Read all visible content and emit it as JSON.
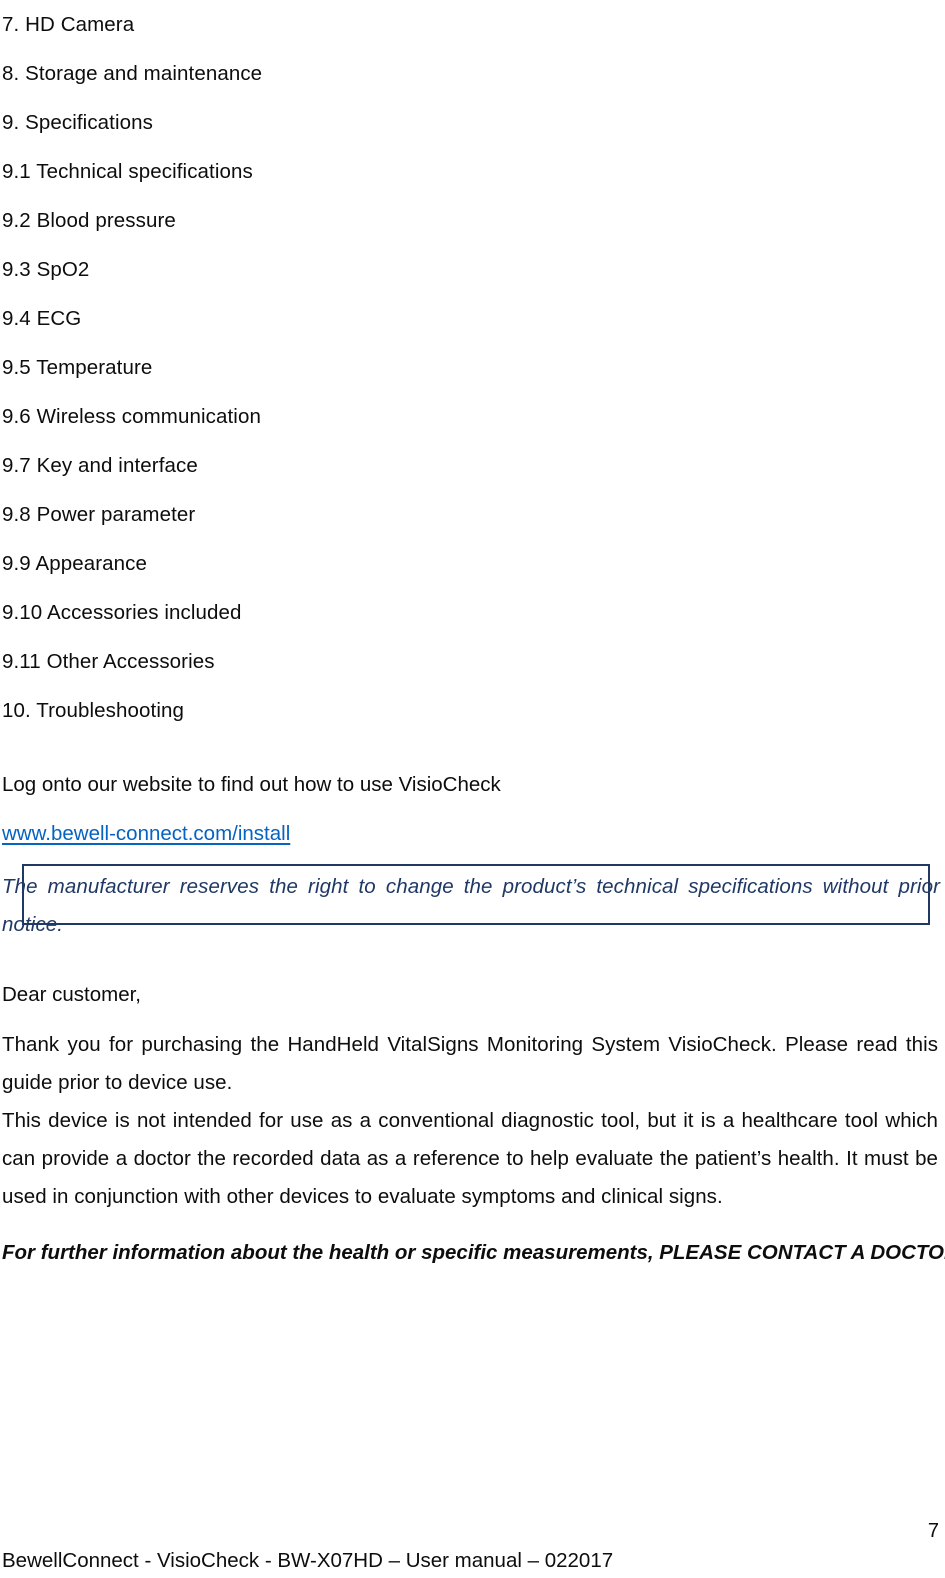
{
  "document": {
    "toc": [
      {
        "label": "7. HD Camera"
      },
      {
        "label": "8. Storage and maintenance"
      },
      {
        "label": "9. Specifications"
      },
      {
        "label": "9.1 Technical specifications"
      },
      {
        "label": "9.2 Blood pressure"
      },
      {
        "label": "9.3 SpO2"
      },
      {
        "label": "9.4 ECG"
      },
      {
        "label": "9.5 Temperature"
      },
      {
        "label": "9.6 Wireless communication"
      },
      {
        "label": "9.7 Key and interface"
      },
      {
        "label": "9.8 Power parameter"
      },
      {
        "label": "9.9 Appearance"
      },
      {
        "label": "9.10 Accessories included"
      },
      {
        "label": "9.11 Other Accessories"
      },
      {
        "label": "10. Troubleshooting"
      }
    ],
    "website": {
      "intro": "Log onto our website to find out how to use VisioCheck",
      "url_text": "www.bewell-connect.com/install",
      "link_color": "#0563C1"
    },
    "notice": {
      "text": "The manufacturer reserves the right to change the product’s technical specifications without prior notice.",
      "border_color": "#1F3864",
      "text_color": "#1F3864"
    },
    "letter": {
      "greeting": "Dear customer,",
      "paragraph_1": "Thank you for purchasing the HandHeld VitalSigns Monitoring System VisioCheck. Please read this guide prior to device use.",
      "paragraph_2": "This device is not intended for use as a conventional diagnostic tool, but it is a healthcare tool which can provide a doctor the recorded data as a reference to help evaluate the patient’s health. It must be used in conjunction with other devices to evaluate symptoms and clinical signs.",
      "closing_note": "For further information about the health or specific measurements, PLEASE CONTACT A DOCTOR."
    },
    "footer": {
      "text": "BewellConnect - VisioCheck - BW-X07HD – User manual – 022017",
      "page_number": "7"
    }
  }
}
